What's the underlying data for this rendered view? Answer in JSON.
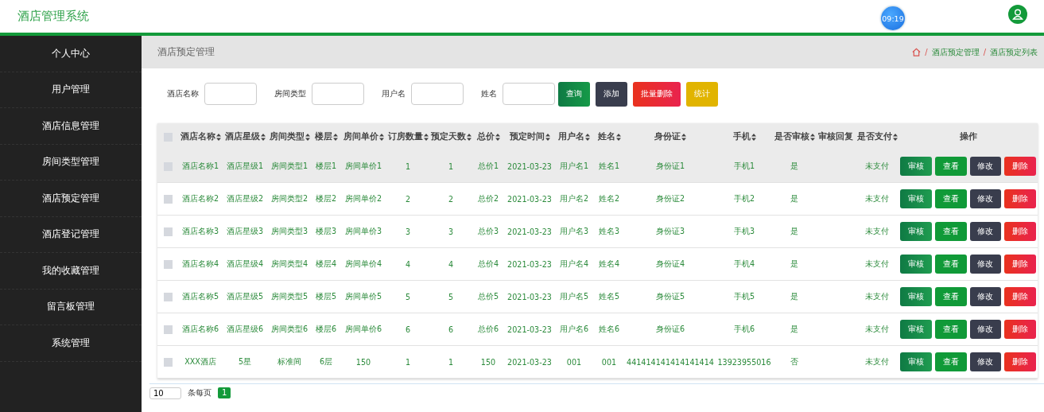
{
  "header": {
    "title": "酒店管理系统",
    "clock": "09:19"
  },
  "sidebar": {
    "items": [
      {
        "label": "个人中心"
      },
      {
        "label": "用户管理"
      },
      {
        "label": "酒店信息管理"
      },
      {
        "label": "房间类型管理"
      },
      {
        "label": "酒店预定管理"
      },
      {
        "label": "酒店登记管理"
      },
      {
        "label": "我的收藏管理"
      },
      {
        "label": "留言板管理"
      },
      {
        "label": "系统管理"
      }
    ]
  },
  "page_title": "酒店预定管理",
  "breadcrumb": [
    {
      "separator": "/",
      "label": "酒店预定管理"
    },
    {
      "separator": "/",
      "label": "酒店预定列表"
    }
  ],
  "search": {
    "fields": [
      {
        "label": "酒店名称"
      },
      {
        "label": "房间类型"
      },
      {
        "label": "用户名"
      },
      {
        "label": "姓名"
      }
    ],
    "buttons": [
      {
        "label": "查询",
        "kind": "search"
      },
      {
        "label": "添加",
        "kind": "add"
      },
      {
        "label": "批量删除",
        "kind": "danger"
      },
      {
        "label": "统计",
        "kind": "stats"
      }
    ]
  },
  "table": {
    "select_all_checked": false,
    "columns": [
      {
        "label": "酒店名称",
        "sortable": true
      },
      {
        "label": "酒店星级",
        "sortable": true
      },
      {
        "label": "房间类型",
        "sortable": true
      },
      {
        "label": "楼层",
        "sortable": true
      },
      {
        "label": "房间单价",
        "sortable": true
      },
      {
        "label": "订房数量",
        "sortable": true
      },
      {
        "label": "预定天数",
        "sortable": true
      },
      {
        "label": "总价",
        "sortable": true
      },
      {
        "label": "预定时间",
        "sortable": true
      },
      {
        "label": "用户名",
        "sortable": true
      },
      {
        "label": "姓名",
        "sortable": true
      },
      {
        "label": "身份证",
        "sortable": true
      },
      {
        "label": "手机",
        "sortable": true
      },
      {
        "label": "是否审核",
        "sortable": true
      },
      {
        "label": "审核回复",
        "sortable": false,
        "kind": "empty"
      },
      {
        "label": "是否支付",
        "sortable": true
      }
    ],
    "actions_label": "操作",
    "rows": [
      {
        "highlighted": true,
        "checked": false,
        "cells": [
          "酒店名称1",
          "酒店星级1",
          "房间类型1",
          "楼层1",
          "房间单价1",
          "1",
          "1",
          "总价1",
          "2021-03-23",
          "用户名1",
          "姓名1",
          "身份证1",
          "手机1",
          "是",
          "未支付"
        ],
        "actions": [
          {
            "label": "审核",
            "kind": "review"
          },
          {
            "label": "查看",
            "kind": "view"
          },
          {
            "label": "修改",
            "kind": "edit"
          },
          {
            "label": "删除",
            "kind": "delete"
          }
        ]
      },
      {
        "highlighted": false,
        "checked": false,
        "cells": [
          "酒店名称2",
          "酒店星级2",
          "房间类型2",
          "楼层2",
          "房间单价2",
          "2",
          "2",
          "总价2",
          "2021-03-23",
          "用户名2",
          "姓名2",
          "身份证2",
          "手机2",
          "是",
          "未支付"
        ],
        "actions": [
          {
            "label": "审核",
            "kind": "review"
          },
          {
            "label": "查看",
            "kind": "view"
          },
          {
            "label": "修改",
            "kind": "edit"
          },
          {
            "label": "删除",
            "kind": "delete"
          }
        ]
      },
      {
        "highlighted": false,
        "checked": false,
        "cells": [
          "酒店名称3",
          "酒店星级3",
          "房间类型3",
          "楼层3",
          "房间单价3",
          "3",
          "3",
          "总价3",
          "2021-03-23",
          "用户名3",
          "姓名3",
          "身份证3",
          "手机3",
          "是",
          "未支付"
        ],
        "actions": [
          {
            "label": "审核",
            "kind": "review"
          },
          {
            "label": "查看",
            "kind": "view"
          },
          {
            "label": "修改",
            "kind": "edit"
          },
          {
            "label": "删除",
            "kind": "delete"
          }
        ]
      },
      {
        "highlighted": false,
        "checked": false,
        "cells": [
          "酒店名称4",
          "酒店星级4",
          "房间类型4",
          "楼层4",
          "房间单价4",
          "4",
          "4",
          "总价4",
          "2021-03-23",
          "用户名4",
          "姓名4",
          "身份证4",
          "手机4",
          "是",
          "未支付"
        ],
        "actions": [
          {
            "label": "审核",
            "kind": "review"
          },
          {
            "label": "查看",
            "kind": "view"
          },
          {
            "label": "修改",
            "kind": "edit"
          },
          {
            "label": "删除",
            "kind": "delete"
          }
        ]
      },
      {
        "highlighted": false,
        "checked": false,
        "cells": [
          "酒店名称5",
          "酒店星级5",
          "房间类型5",
          "楼层5",
          "房间单价5",
          "5",
          "5",
          "总价5",
          "2021-03-23",
          "用户名5",
          "姓名5",
          "身份证5",
          "手机5",
          "是",
          "未支付"
        ],
        "actions": [
          {
            "label": "审核",
            "kind": "review"
          },
          {
            "label": "查看",
            "kind": "view"
          },
          {
            "label": "修改",
            "kind": "edit"
          },
          {
            "label": "删除",
            "kind": "delete"
          }
        ]
      },
      {
        "highlighted": false,
        "checked": false,
        "cells": [
          "酒店名称6",
          "酒店星级6",
          "房间类型6",
          "楼层6",
          "房间单价6",
          "6",
          "6",
          "总价6",
          "2021-03-23",
          "用户名6",
          "姓名6",
          "身份证6",
          "手机6",
          "是",
          "未支付"
        ],
        "actions": [
          {
            "label": "审核",
            "kind": "review"
          },
          {
            "label": "查看",
            "kind": "view"
          },
          {
            "label": "修改",
            "kind": "edit"
          },
          {
            "label": "删除",
            "kind": "delete"
          }
        ]
      },
      {
        "highlighted": false,
        "checked": false,
        "cells": [
          "XXX酒店",
          "5星",
          "标准间",
          "6层",
          "150",
          "1",
          "1",
          "150",
          "2021-03-23",
          "001",
          "001",
          "441414141414141414",
          "13923955016",
          "否",
          "未支付"
        ],
        "actions": [
          {
            "label": "审核",
            "kind": "review"
          },
          {
            "label": "查看",
            "kind": "view"
          },
          {
            "label": "修改",
            "kind": "edit"
          },
          {
            "label": "删除",
            "kind": "delete"
          }
        ]
      }
    ]
  },
  "pagination": {
    "page_size": "10",
    "page_size_label": "条每页",
    "current_page": "1"
  }
}
